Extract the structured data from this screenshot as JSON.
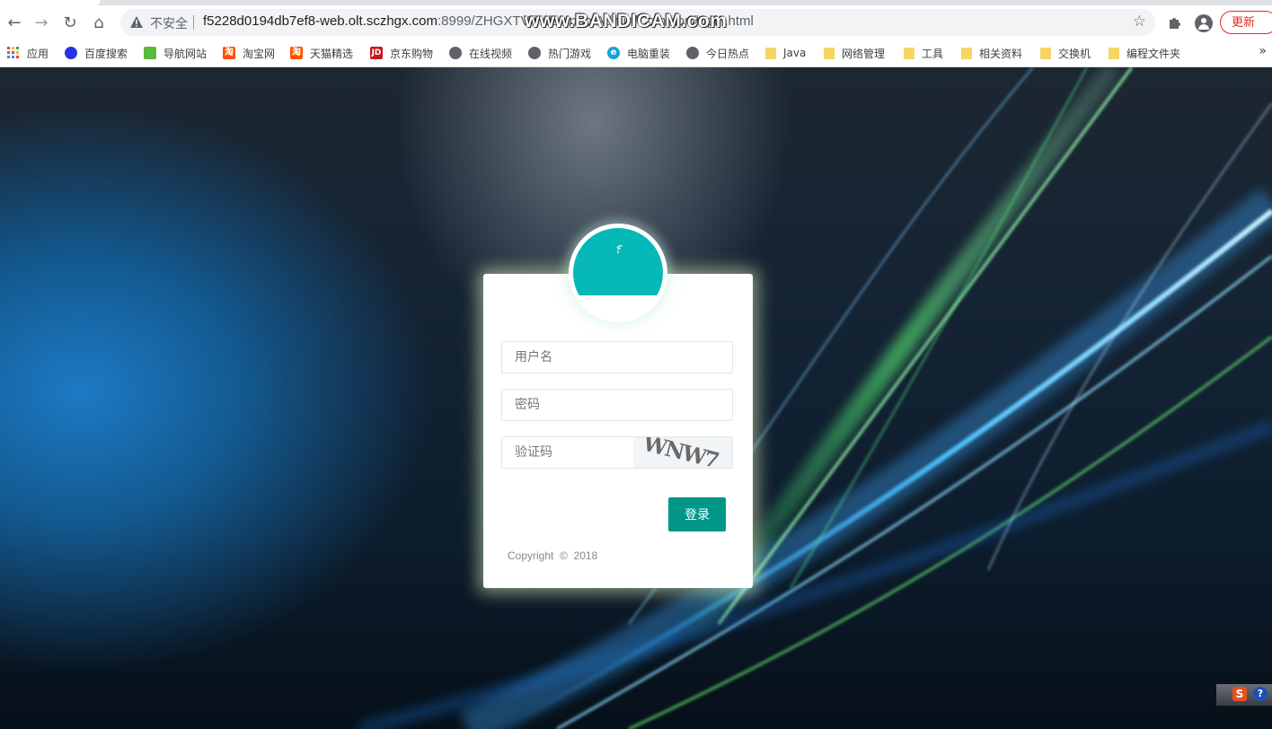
{
  "browser": {
    "insecure_label": "不安全",
    "url_host": "f5228d0194db7ef8-web.olt.sczhgx.com",
    "url_path": ":8999/ZHGXTV/index.php/Admin/Common/login.html",
    "update_label": "更新",
    "watermark": "www.BANDICAM.com"
  },
  "bookmarks": [
    {
      "label": "应用",
      "icon": "apps-grid-icon"
    },
    {
      "label": "百度搜索",
      "icon": "baidu-icon"
    },
    {
      "label": "导航网站",
      "icon": "hao123-icon"
    },
    {
      "label": "淘宝网",
      "icon": "taobao-icon"
    },
    {
      "label": "天猫精选",
      "icon": "taobao-icon"
    },
    {
      "label": "京东购物",
      "icon": "jd-icon"
    },
    {
      "label": "在线视频",
      "icon": "globe-icon"
    },
    {
      "label": "热门游戏",
      "icon": "globe-icon"
    },
    {
      "label": "电脑重装",
      "icon": "ie-icon"
    },
    {
      "label": "今日热点",
      "icon": "globe-icon"
    },
    {
      "label": "Java",
      "icon": "folder-icon"
    },
    {
      "label": "网络管理",
      "icon": "folder-icon"
    },
    {
      "label": "工具",
      "icon": "folder-icon"
    },
    {
      "label": "相关资料",
      "icon": "folder-icon"
    },
    {
      "label": "交换机",
      "icon": "folder-icon"
    },
    {
      "label": "编程文件夹",
      "icon": "folder-icon"
    }
  ],
  "login": {
    "username_placeholder": "用户名",
    "password_placeholder": "密码",
    "captcha_placeholder": "验证码",
    "captcha_text": "WNW7",
    "submit_label": "登录",
    "copyright": "Copyright  ©  2018",
    "accent": "#009688",
    "avatar_color": "#06b8b8"
  },
  "tray": {
    "s_label": "S",
    "help_label": "?"
  }
}
